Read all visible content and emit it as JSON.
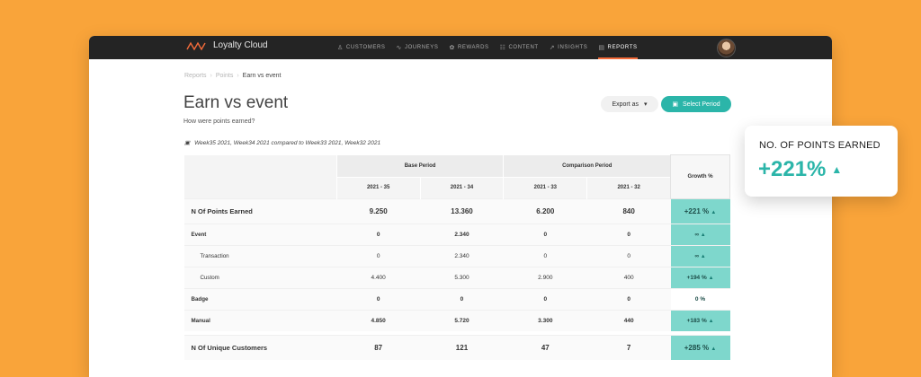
{
  "brand": {
    "name": "Loyalty Cloud"
  },
  "nav": [
    {
      "label": "CUSTOMERS",
      "icon": "user-icon",
      "glyph": "♙",
      "active": false
    },
    {
      "label": "JOURNEYS",
      "icon": "journey-icon",
      "glyph": "∿",
      "active": false
    },
    {
      "label": "REWARDS",
      "icon": "gift-icon",
      "glyph": "✿",
      "active": false
    },
    {
      "label": "CONTENT",
      "icon": "content-icon",
      "glyph": "☷",
      "active": false
    },
    {
      "label": "INSIGHTS",
      "icon": "insights-icon",
      "glyph": "↗",
      "active": false
    },
    {
      "label": "REPORTS",
      "icon": "reports-icon",
      "glyph": "▤",
      "active": true
    }
  ],
  "breadcrumb": {
    "item1": "Reports",
    "item2": "Points",
    "current": "Earn vs event",
    "sep": "›"
  },
  "page": {
    "title": "Earn vs event",
    "subtitle": "How were points earned?"
  },
  "actions": {
    "export_label": "Export as",
    "export_caret": "▾",
    "period_label": "Select Period",
    "period_icon": "▣"
  },
  "comparison": {
    "icon": "▣",
    "text": "Week35 2021, Week34 2021 compared to Week33 2021, Week32 2021"
  },
  "table": {
    "base_period": "Base Period",
    "comparison_period": "Comparison Period",
    "growth_header": "Growth %",
    "columns": [
      "2021 - 35",
      "2021 - 34",
      "2021 - 33",
      "2021 - 32"
    ],
    "rows": [
      {
        "label": "N Of Points Earned",
        "v": [
          "9.250",
          "13.360",
          "6.200",
          "840"
        ],
        "growth": "+221 %",
        "arrow": "▲"
      },
      {
        "label": "Event",
        "v": [
          "0",
          "2.340",
          "0",
          "0"
        ],
        "growth": "∞",
        "arrow": "▲"
      },
      {
        "label": "Transaction",
        "v": [
          "0",
          "2.340",
          "0",
          "0"
        ],
        "growth": "∞",
        "arrow": "▲"
      },
      {
        "label": "Custom",
        "v": [
          "4.400",
          "5.300",
          "2.900",
          "400"
        ],
        "growth": "+194 %",
        "arrow": "▲"
      },
      {
        "label": "Badge",
        "v": [
          "0",
          "0",
          "0",
          "0"
        ],
        "growth": "0 %",
        "arrow": ""
      },
      {
        "label": "Manual",
        "v": [
          "4.850",
          "5.720",
          "3.300",
          "440"
        ],
        "growth": "+183 %",
        "arrow": "▲"
      },
      {
        "label": "N Of Unique Customers",
        "v": [
          "87",
          "121",
          "47",
          "7"
        ],
        "growth": "+285 %",
        "arrow": "▲"
      }
    ]
  },
  "kpi": {
    "label": "NO. OF POINTS EARNED",
    "value": "+221%",
    "arrow": "▲"
  },
  "colors": {
    "background": "#F9A43A",
    "accent": "#2BB5A9",
    "growth_cell": "#7ED7CC",
    "nav_active": "#F36B3A"
  }
}
